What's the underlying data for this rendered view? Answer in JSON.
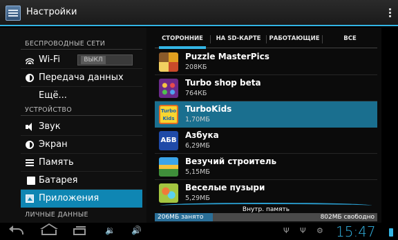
{
  "actionbar": {
    "title": "Настройки"
  },
  "left": {
    "sections": {
      "wireless": "БЕСПРОВОДНЫЕ СЕТИ",
      "device": "УСТРОЙСТВО",
      "personal": "ЛИЧНЫЕ ДАННЫЕ"
    },
    "items": [
      {
        "label": "Wi-Fi",
        "icon": "wifi-icon"
      },
      {
        "label": "Передача данных",
        "icon": "data-usage-icon"
      },
      {
        "label": "Ещё...",
        "icon": ""
      },
      {
        "label": "Звук",
        "icon": "sound-icon"
      },
      {
        "label": "Экран",
        "icon": "display-icon"
      },
      {
        "label": "Память",
        "icon": "storage-icon"
      },
      {
        "label": "Батарея",
        "icon": "battery-icon"
      },
      {
        "label": "Приложения",
        "icon": "apps-icon",
        "selected": true
      }
    ],
    "wifi_toggle": "ВЫКЛ"
  },
  "tabs": [
    "СТОРОННИЕ",
    "НА SD-КАРТЕ",
    "РАБОТАЮЩИЕ",
    "ВСЕ"
  ],
  "apps": [
    {
      "name": "Puzzle MasterPics",
      "size": "208КБ"
    },
    {
      "name": "Turbo shop beta",
      "size": "764КБ"
    },
    {
      "name": "TurboKids",
      "size": "1,70МБ",
      "selected": true
    },
    {
      "name": "Азбука",
      "size": "6,29МБ"
    },
    {
      "name": "Везучий строитель",
      "size": "5,15МБ"
    },
    {
      "name": "Веселые пузыри",
      "size": "5,29МБ"
    }
  ],
  "app_icon_text": {
    "turbo": "Turbo Kids",
    "abc": "АБВ"
  },
  "storage": {
    "label": "Внутр. память",
    "used": "206МБ занято",
    "free": "802МБ свободно",
    "used_fraction": 0.26
  },
  "statusbar": {
    "time": "15:47"
  },
  "colors": {
    "accent": "#33b5e5",
    "selected": "#0f86b3"
  }
}
